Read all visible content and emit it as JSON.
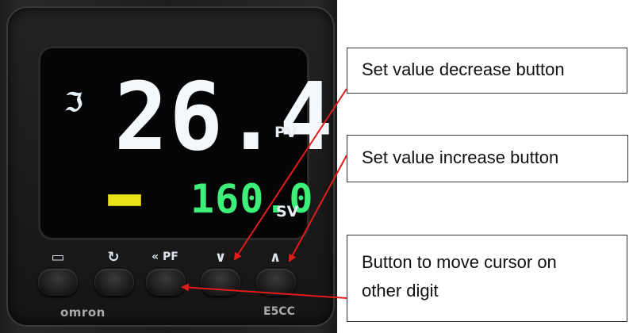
{
  "display": {
    "unit_symbol": "ℑ",
    "pv_value": "26.4",
    "pv_label": "PV",
    "sv_value": "160.0",
    "sv_label": "SV"
  },
  "keys": [
    {
      "icon": "level-icon",
      "glyph": "▭"
    },
    {
      "icon": "mode-icon",
      "glyph": "↻"
    },
    {
      "icon": "pf-shift-icon",
      "glyph": "« PF"
    },
    {
      "icon": "down-icon",
      "glyph": "∨"
    },
    {
      "icon": "up-icon",
      "glyph": "∧"
    }
  ],
  "brand": {
    "maker": "omron",
    "model": "E5CC"
  },
  "callouts": {
    "decrease": "Set value decrease button",
    "increase": "Set value increase button",
    "cursor_line1": "Button to move cursor on",
    "cursor_line2": "other digit"
  },
  "colors": {
    "pv": "#f4f8fb",
    "sv": "#3ef07a",
    "indicator": "#e8e218",
    "arrow": "#e21b1b"
  }
}
